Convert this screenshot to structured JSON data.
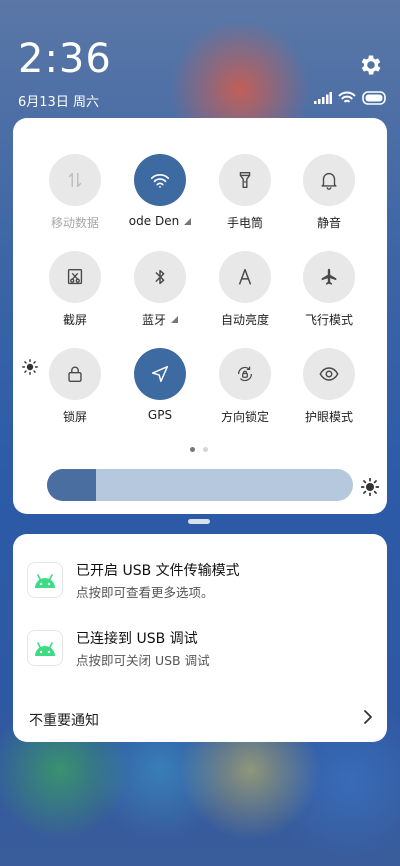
{
  "status_bar": {
    "time": "2:36",
    "date": "6月13日 周六",
    "icons": [
      "signal-icon",
      "wifi-icon",
      "battery-icon"
    ]
  },
  "quick_settings": {
    "tiles": [
      {
        "label": "移动数据",
        "icon": "mobile-data-icon",
        "active": false,
        "disabled": true
      },
      {
        "label": "ode Den",
        "icon": "wifi-icon",
        "active": true,
        "has_more": true
      },
      {
        "label": "手电筒",
        "icon": "flashlight-icon",
        "active": false
      },
      {
        "label": "静音",
        "icon": "bell-icon",
        "active": false
      },
      {
        "label": "截屏",
        "icon": "screenshot-icon",
        "active": false
      },
      {
        "label": "蓝牙",
        "icon": "bluetooth-icon",
        "active": false,
        "has_more": true
      },
      {
        "label": "自动亮度",
        "icon": "auto-brightness-icon",
        "active": false
      },
      {
        "label": "飞行模式",
        "icon": "airplane-icon",
        "active": false
      },
      {
        "label": "锁屏",
        "icon": "lock-icon",
        "active": false
      },
      {
        "label": "GPS",
        "icon": "gps-icon",
        "active": true
      },
      {
        "label": "方向锁定",
        "icon": "rotation-lock-icon",
        "active": false
      },
      {
        "label": "护眼模式",
        "icon": "eye-icon",
        "active": false
      }
    ],
    "page_indicator": {
      "pages": 2,
      "current": 1
    },
    "brightness_level": 0.16,
    "colors": {
      "active": "#3e6aa2",
      "inactive": "#e8e8e8",
      "brightness_track": "#b6c8de",
      "brightness_fill": "#4a6ea0"
    }
  },
  "notifications": {
    "items": [
      {
        "title": "已开启 USB 文件传输模式",
        "subtitle": "点按即可查看更多选项。",
        "icon": "android-icon"
      },
      {
        "title": "已连接到 USB 调试",
        "subtitle": "点按即可关闭 USB 调试",
        "icon": "android-icon"
      }
    ],
    "unimportant_label": "不重要通知"
  }
}
